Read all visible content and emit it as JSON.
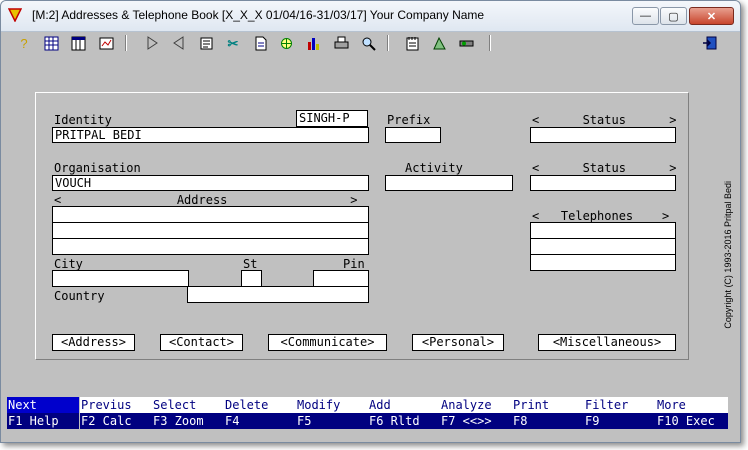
{
  "window": {
    "title": "[M:2]  Addresses & Telephone Book  [X_X_X  01/04/16-31/03/17]  Your Company Name",
    "min_label": "—",
    "max_label": "▢",
    "close_label": "✕"
  },
  "toolbar": {
    "icons": [
      "help-icon",
      "grid-icon",
      "table-icon",
      "report-icon",
      "next-icon",
      "previous-icon",
      "form-icon",
      "tools-icon",
      "document-icon",
      "process-icon",
      "chart-icon",
      "print-icon",
      "search-icon",
      "notes-icon",
      "design-icon",
      "settings-icon",
      "exit-icon"
    ]
  },
  "form": {
    "identity_label": "Identity",
    "identity_code": "SINGH-P",
    "identity_value": "PRITPAL BEDI",
    "prefix_label": "Prefix",
    "prefix_value": "",
    "status1_label": "<      Status      >",
    "status1_value": "",
    "organisation_label": "Organisation",
    "organisation_value": "VOUCH",
    "activity_label": "Activity",
    "activity_value": "",
    "status2_label": "<      Status      >",
    "status2_value": "",
    "address_label": "<                Address                 >",
    "address_lines": [
      "",
      "",
      ""
    ],
    "telephones_label": "<   Telephones    >",
    "telephones_lines": [
      "",
      "",
      ""
    ],
    "city_label": "City",
    "city_value": "",
    "st_label": "St",
    "st_value": "",
    "pin_label": "Pin",
    "pin_value": "",
    "country_label": "Country",
    "country_value": ""
  },
  "tabs": [
    "<Address>",
    "<Contact>",
    "<Communicate>",
    "<Personal>",
    "<Miscellaneous>"
  ],
  "copyright": "Copyright (C) 1993-2016 Pritpal Bedi",
  "fkeys": [
    {
      "top": "Next",
      "bottom": "F1 Help",
      "active": true
    },
    {
      "top": "Previus",
      "bottom": "F2 Calc"
    },
    {
      "top": "Select",
      "bottom": "F3 Zoom"
    },
    {
      "top": "Delete",
      "bottom": "F4"
    },
    {
      "top": "Modify",
      "bottom": "F5"
    },
    {
      "top": "Add",
      "bottom": "F6 Rltd"
    },
    {
      "top": "Analyze",
      "bottom": "F7 <<>>"
    },
    {
      "top": "Print",
      "bottom": "F8"
    },
    {
      "top": "Filter",
      "bottom": "F9"
    },
    {
      "top": "More",
      "bottom": "F10 Exec"
    }
  ]
}
